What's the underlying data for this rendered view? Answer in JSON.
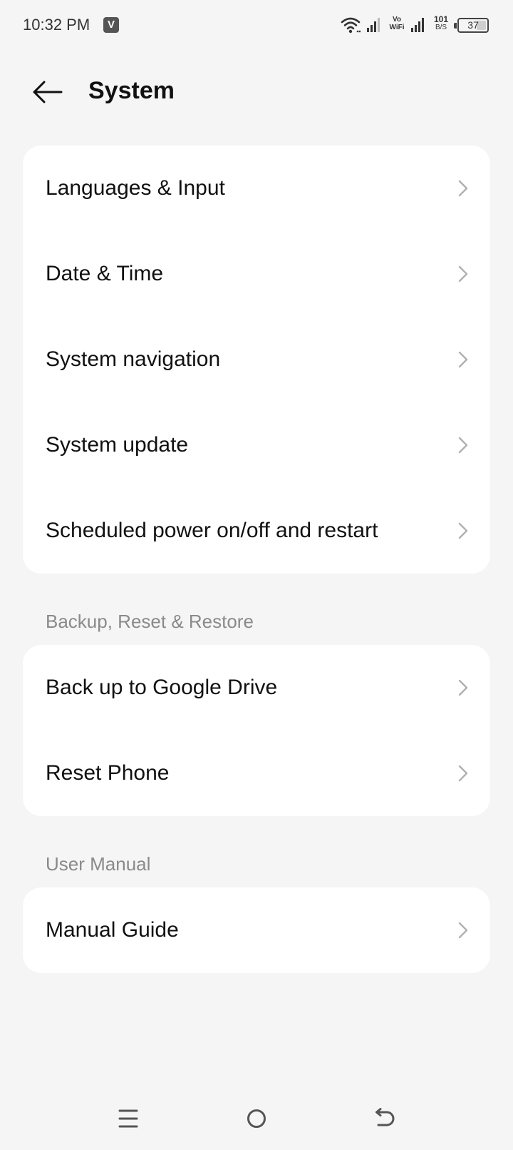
{
  "status_bar": {
    "time": "10:32 PM",
    "app_badge": "V",
    "vowifi": [
      "Vo",
      "WiFi"
    ],
    "net_speed_value": "101",
    "net_speed_unit": "B/S",
    "battery_level": "37",
    "battery_fraction": 0.37
  },
  "header": {
    "title": "System",
    "back_icon": "arrow-left-icon"
  },
  "sections": [
    {
      "title": "",
      "items": [
        {
          "label": "Languages & Input"
        },
        {
          "label": "Date & Time"
        },
        {
          "label": "System navigation"
        },
        {
          "label": "System update"
        },
        {
          "label": "Scheduled power on/off and restart"
        }
      ]
    },
    {
      "title": "Backup, Reset & Restore",
      "items": [
        {
          "label": "Back up to Google Drive"
        },
        {
          "label": "Reset Phone"
        }
      ]
    },
    {
      "title": "User Manual",
      "items": [
        {
          "label": "Manual Guide"
        }
      ]
    }
  ],
  "nav_bar": {
    "menu_icon": "menu-icon",
    "home_icon": "home-circle-icon",
    "back_icon": "back-return-icon"
  },
  "colors": {
    "background": "#f5f5f5",
    "card": "#ffffff",
    "chevron": "#b0b0b0",
    "section_header": "#8a8a8a"
  }
}
